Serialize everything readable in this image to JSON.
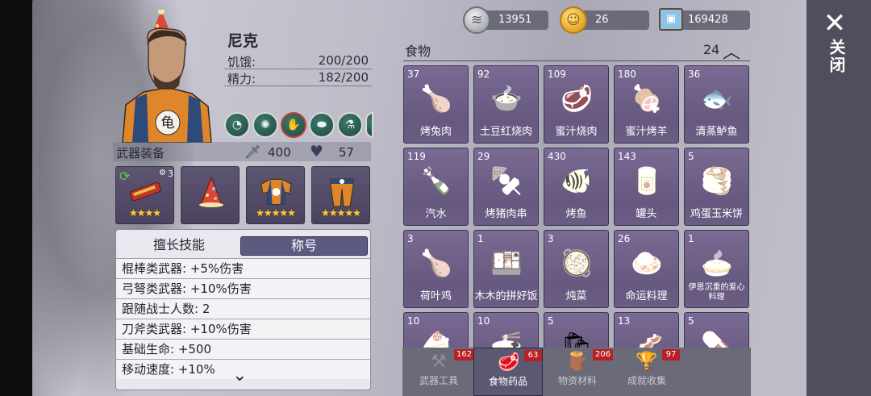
{
  "resources": {
    "cans": "13951",
    "coins": "26",
    "photos": "169428"
  },
  "close": {
    "label": "关闭",
    "icon": "close-x-icon"
  },
  "hero": {
    "name": "尼克",
    "hunger_label": "饥饿:",
    "hunger_value": "200/200",
    "energy_label": "精力:",
    "energy_value": "182/200"
  },
  "weapons": {
    "title": "武器装备",
    "attack": "400",
    "health": "57",
    "equip_badge": "3"
  },
  "skills": {
    "tab_skill": "擅长技能",
    "tab_title": "称号",
    "rows": [
      "棍棒类武器:  +5%伤害",
      "弓弩类武器:  +10%伤害",
      "跟随战士人数:  2",
      "刀斧类武器:  +10%伤害",
      "基础生命:  +500",
      "移动速度:  +10%"
    ]
  },
  "food": {
    "title": "食物",
    "count": "24",
    "items": [
      {
        "qty": "37",
        "name": "烤兔肉"
      },
      {
        "qty": "92",
        "name": "土豆红烧肉"
      },
      {
        "qty": "109",
        "name": "蜜汁烧肉"
      },
      {
        "qty": "180",
        "name": "蜜汁烤羊"
      },
      {
        "qty": "36",
        "name": "清蒸鲈鱼"
      },
      {
        "qty": "119",
        "name": "汽水"
      },
      {
        "qty": "29",
        "name": "烤猪肉串"
      },
      {
        "qty": "430",
        "name": "烤鱼"
      },
      {
        "qty": "143",
        "name": "罐头"
      },
      {
        "qty": "5",
        "name": "鸡蛋玉米饼"
      },
      {
        "qty": "3",
        "name": "荷叶鸡"
      },
      {
        "qty": "1",
        "name": "木木的拼好饭"
      },
      {
        "qty": "3",
        "name": "炖菜"
      },
      {
        "qty": "26",
        "name": "命运料理"
      },
      {
        "qty": "1",
        "name": "伊恩沉重的爱心料理"
      },
      {
        "qty": "10",
        "name": ""
      },
      {
        "qty": "10",
        "name": ""
      },
      {
        "qty": "5",
        "name": ""
      },
      {
        "qty": "13",
        "name": ""
      },
      {
        "qty": "5",
        "name": ""
      }
    ]
  },
  "tabs": [
    {
      "label": "武器工具",
      "badge": "162"
    },
    {
      "label": "食物药品",
      "badge": "63"
    },
    {
      "label": "物资材料",
      "badge": "206"
    },
    {
      "label": "成就收集",
      "badge": "97"
    }
  ]
}
